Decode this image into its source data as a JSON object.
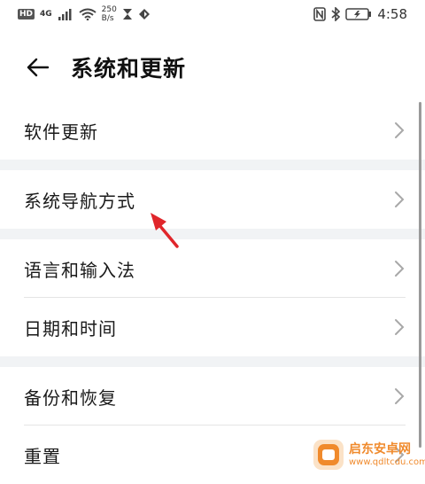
{
  "status_bar": {
    "hd": "HD",
    "network": "4G",
    "speed_value": "250",
    "speed_unit": "B/s",
    "time": "4:58"
  },
  "header": {
    "title": "系统和更新"
  },
  "groups": [
    {
      "items": [
        {
          "label": "软件更新"
        }
      ]
    },
    {
      "items": [
        {
          "label": "系统导航方式"
        }
      ]
    },
    {
      "items": [
        {
          "label": "语言和输入法"
        },
        {
          "label": "日期和时间"
        }
      ]
    },
    {
      "items": [
        {
          "label": "备份和恢复"
        },
        {
          "label": "重置"
        }
      ]
    }
  ],
  "watermark": {
    "title": "启东安卓网",
    "url": "www.qdltcdu.com"
  },
  "colors": {
    "section_gap": "#f1f3f5",
    "annotation_arrow": "#e0262b",
    "watermark": "#f08a2c"
  }
}
